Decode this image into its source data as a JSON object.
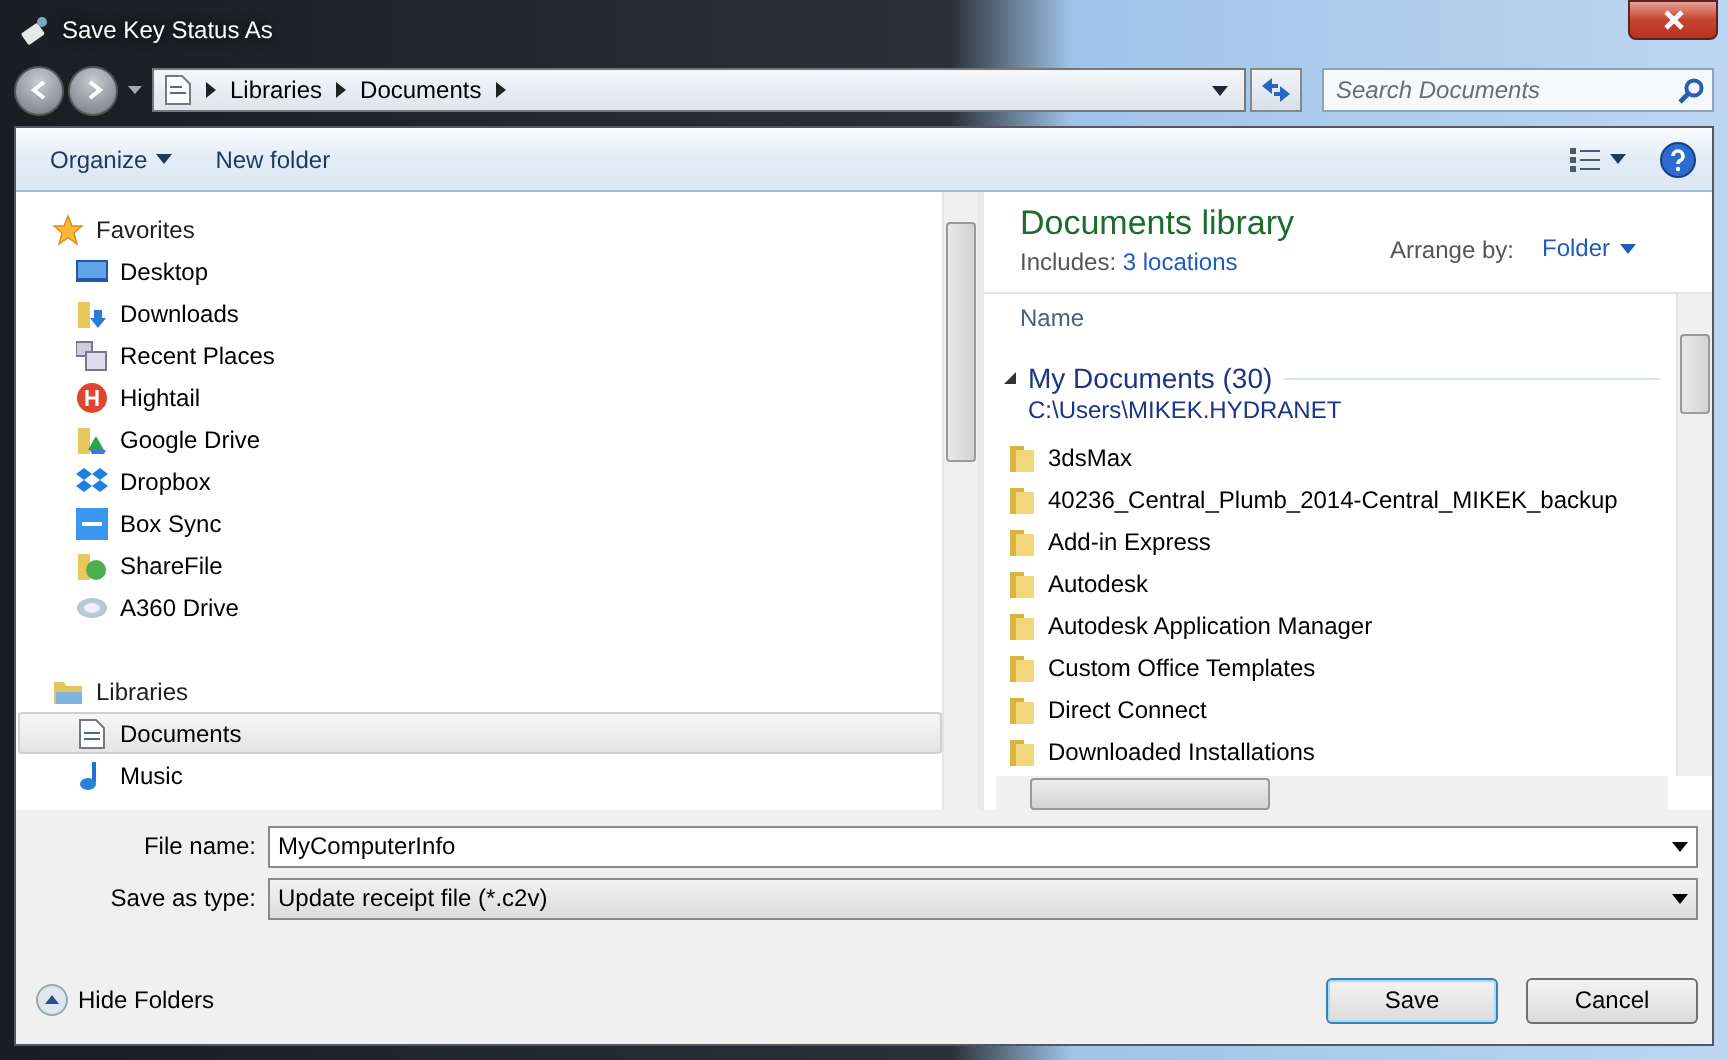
{
  "window": {
    "title": "Save Key Status As"
  },
  "address": {
    "crumbs": [
      "Libraries",
      "Documents"
    ]
  },
  "search": {
    "placeholder": "Search Documents"
  },
  "toolbar": {
    "organize": "Organize",
    "new_folder": "New folder"
  },
  "nav": {
    "groups": [
      {
        "label": "Favorites",
        "items": [
          {
            "label": "Desktop",
            "selected": false
          },
          {
            "label": "Downloads",
            "selected": false
          },
          {
            "label": "Recent Places",
            "selected": false
          },
          {
            "label": "Hightail",
            "selected": false
          },
          {
            "label": "Google Drive",
            "selected": false
          },
          {
            "label": "Dropbox",
            "selected": false
          },
          {
            "label": "Box Sync",
            "selected": false
          },
          {
            "label": "ShareFile",
            "selected": false
          },
          {
            "label": "A360 Drive",
            "selected": false
          }
        ]
      },
      {
        "label": "Libraries",
        "items": [
          {
            "label": "Documents",
            "selected": true
          },
          {
            "label": "Music",
            "selected": false
          }
        ]
      }
    ]
  },
  "library": {
    "title": "Documents library",
    "includes_label": "Includes:",
    "includes_link": "3 locations",
    "arrange_label": "Arrange by:",
    "arrange_value": "Folder"
  },
  "list": {
    "column": "Name",
    "group": {
      "title": "My Documents (30)",
      "path": "C:\\Users\\MIKEK.HYDRANET",
      "expanded": true
    },
    "folders": [
      "3dsMax",
      "40236_Central_Plumb_2014-Central_MIKEK_backup",
      "Add-in Express",
      "Autodesk",
      "Autodesk Application Manager",
      "Custom Office Templates",
      "Direct Connect",
      "Downloaded Installations"
    ]
  },
  "form": {
    "file_name_label": "File name:",
    "file_name": "MyComputerInfo",
    "type_label": "Save as type:",
    "type_value": "Update receipt file (*.c2v)"
  },
  "footer": {
    "hide_folders": "Hide Folders",
    "buttons": [
      "Save",
      "Cancel"
    ]
  }
}
